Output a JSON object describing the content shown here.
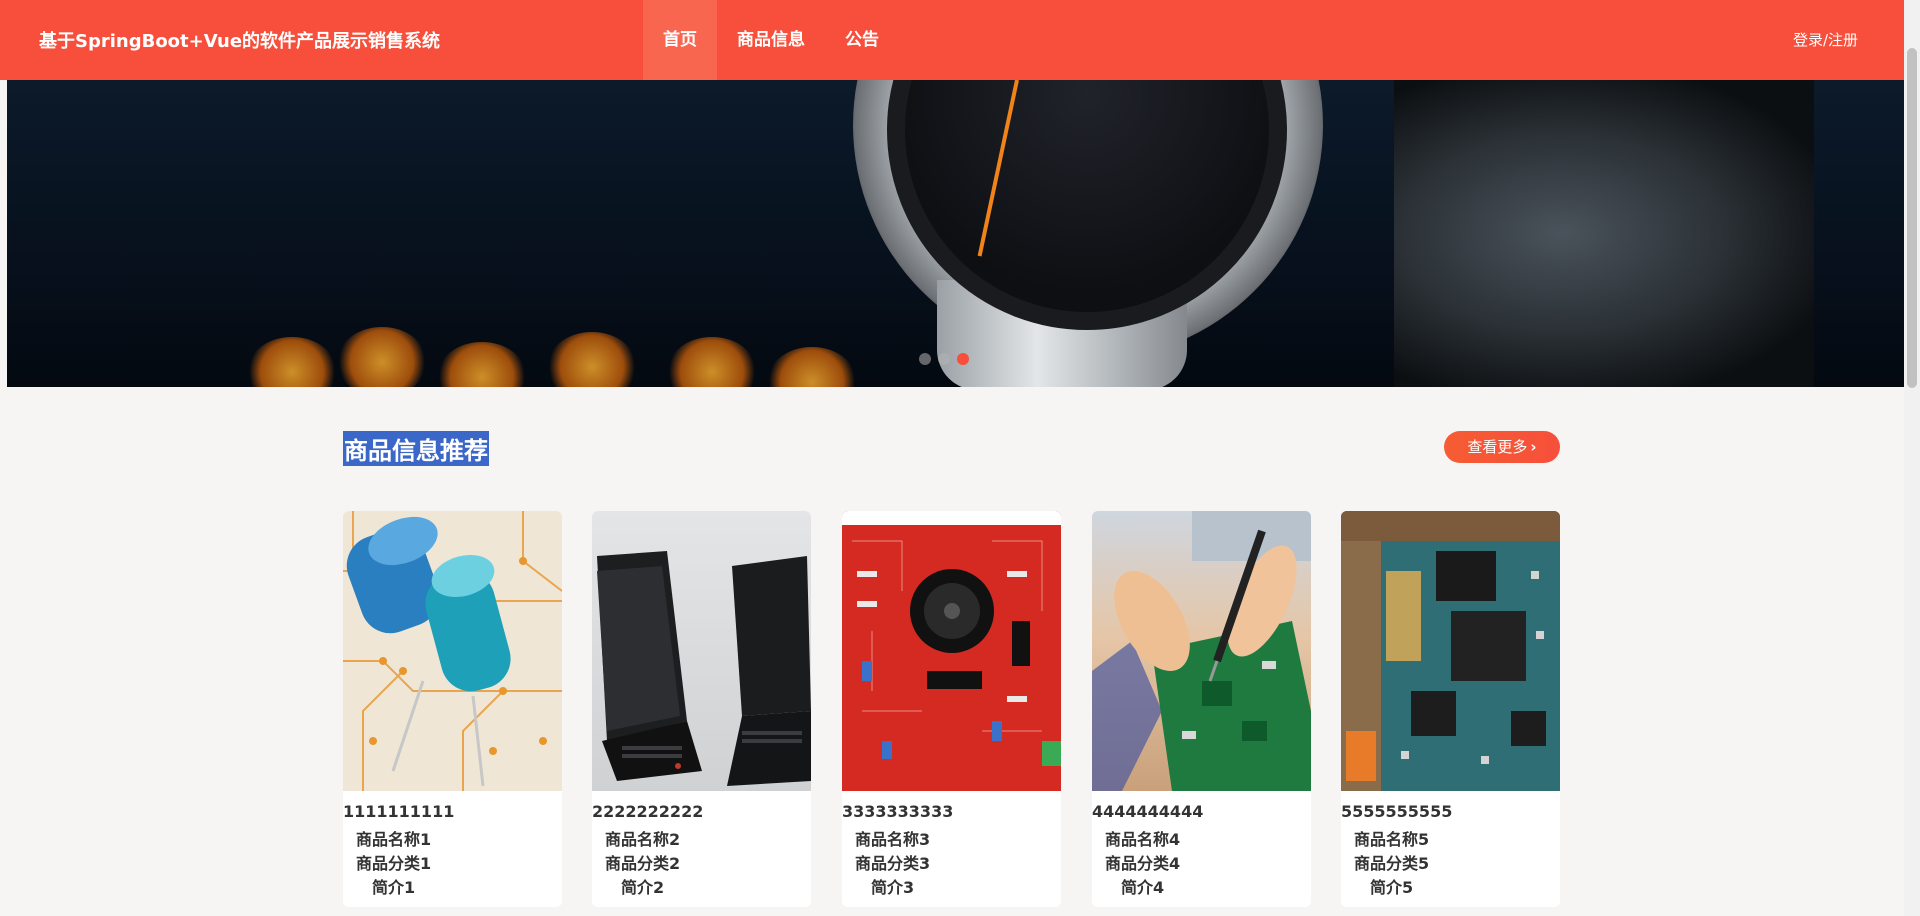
{
  "header": {
    "title": "基于SpringBoot+Vue的软件产品展示销售系统",
    "nav": [
      "首页",
      "商品信息",
      "公告"
    ],
    "active_nav": "首页",
    "login": "登录/注册",
    "accent_color": "#f74f3b"
  },
  "carousel": {
    "slide_count": 3,
    "active_index": 2
  },
  "section": {
    "title": "商品信息推荐",
    "more_label": "查看更多",
    "more_icon": "chevron-right-icon"
  },
  "products": [
    {
      "code": "1111111111",
      "name": "商品名称1",
      "category": "商品分类1",
      "intro": "简介1"
    },
    {
      "code": "2222222222",
      "name": "商品名称2",
      "category": "商品分类2",
      "intro": "简介2"
    },
    {
      "code": "3333333333",
      "name": "商品名称3",
      "category": "商品分类3",
      "intro": "简介3"
    },
    {
      "code": "4444444444",
      "name": "商品名称4",
      "category": "商品分类4",
      "intro": "简介4"
    },
    {
      "code": "5555555555",
      "name": "商品名称5",
      "category": "商品分类5",
      "intro": "简介5"
    }
  ]
}
